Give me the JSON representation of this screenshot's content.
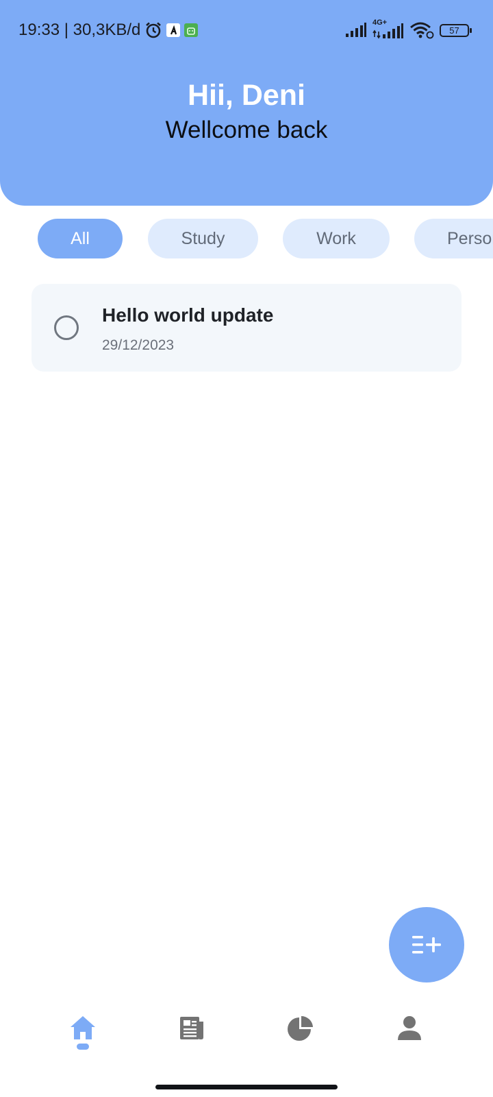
{
  "status_bar": {
    "time_speed": "19:33 | 30,3KB/d",
    "network_label": "4G+",
    "battery": "57",
    "icons": [
      "alarm-icon",
      "app-notification-icon",
      "android-notification-icon",
      "signal-icon",
      "signal-4g-icon",
      "wifi-icon",
      "battery-icon"
    ]
  },
  "header": {
    "greeting": "Hii, Deni",
    "subtitle": "Wellcome back"
  },
  "categories": {
    "items": [
      {
        "label": "All",
        "active": true
      },
      {
        "label": "Study",
        "active": false
      },
      {
        "label": "Work",
        "active": false
      },
      {
        "label": "Personal",
        "active": false
      }
    ]
  },
  "tasks": [
    {
      "title": "Hello world update",
      "date": "29/12/2023",
      "done": false
    }
  ],
  "fab": {
    "icon": "add-list-icon"
  },
  "bottom_nav": {
    "items": [
      {
        "icon": "home-icon",
        "active": true
      },
      {
        "icon": "news-icon",
        "active": false
      },
      {
        "icon": "pie-chart-icon",
        "active": false
      },
      {
        "icon": "person-icon",
        "active": false
      }
    ]
  },
  "colors": {
    "accent": "#7dabf6",
    "chip_inactive": "#dfebfd",
    "card": "#f3f7fb",
    "icon_inactive": "#737373"
  }
}
